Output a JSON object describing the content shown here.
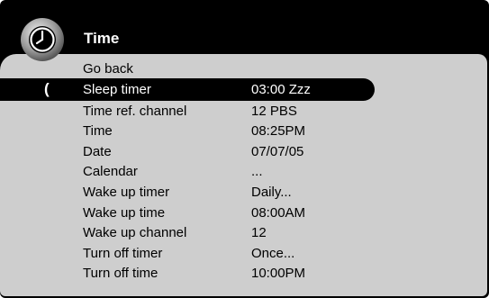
{
  "header": {
    "title": "Time",
    "icon": "clock-icon"
  },
  "menu": {
    "cursor_glyph": "(",
    "items": [
      {
        "label": "Go back",
        "value": ""
      },
      {
        "label": "Sleep timer",
        "value": "03:00 Zzz"
      },
      {
        "label": "Time ref. channel",
        "value": "12 PBS"
      },
      {
        "label": "Time",
        "value": "08:25PM"
      },
      {
        "label": "Date",
        "value": "07/07/05"
      },
      {
        "label": "Calendar",
        "value": "..."
      },
      {
        "label": "Wake up timer",
        "value": "Daily..."
      },
      {
        "label": "Wake up time",
        "value": "08:00AM"
      },
      {
        "label": "Wake up channel",
        "value": "12"
      },
      {
        "label": "Turn off timer",
        "value": "Once..."
      },
      {
        "label": "Turn off time",
        "value": "10:00PM"
      }
    ],
    "selected_index": 1
  },
  "colors": {
    "background": "#000000",
    "panel": "#cecece",
    "selection": "#000000",
    "text": "#000000",
    "selected_text": "#ffffff"
  }
}
